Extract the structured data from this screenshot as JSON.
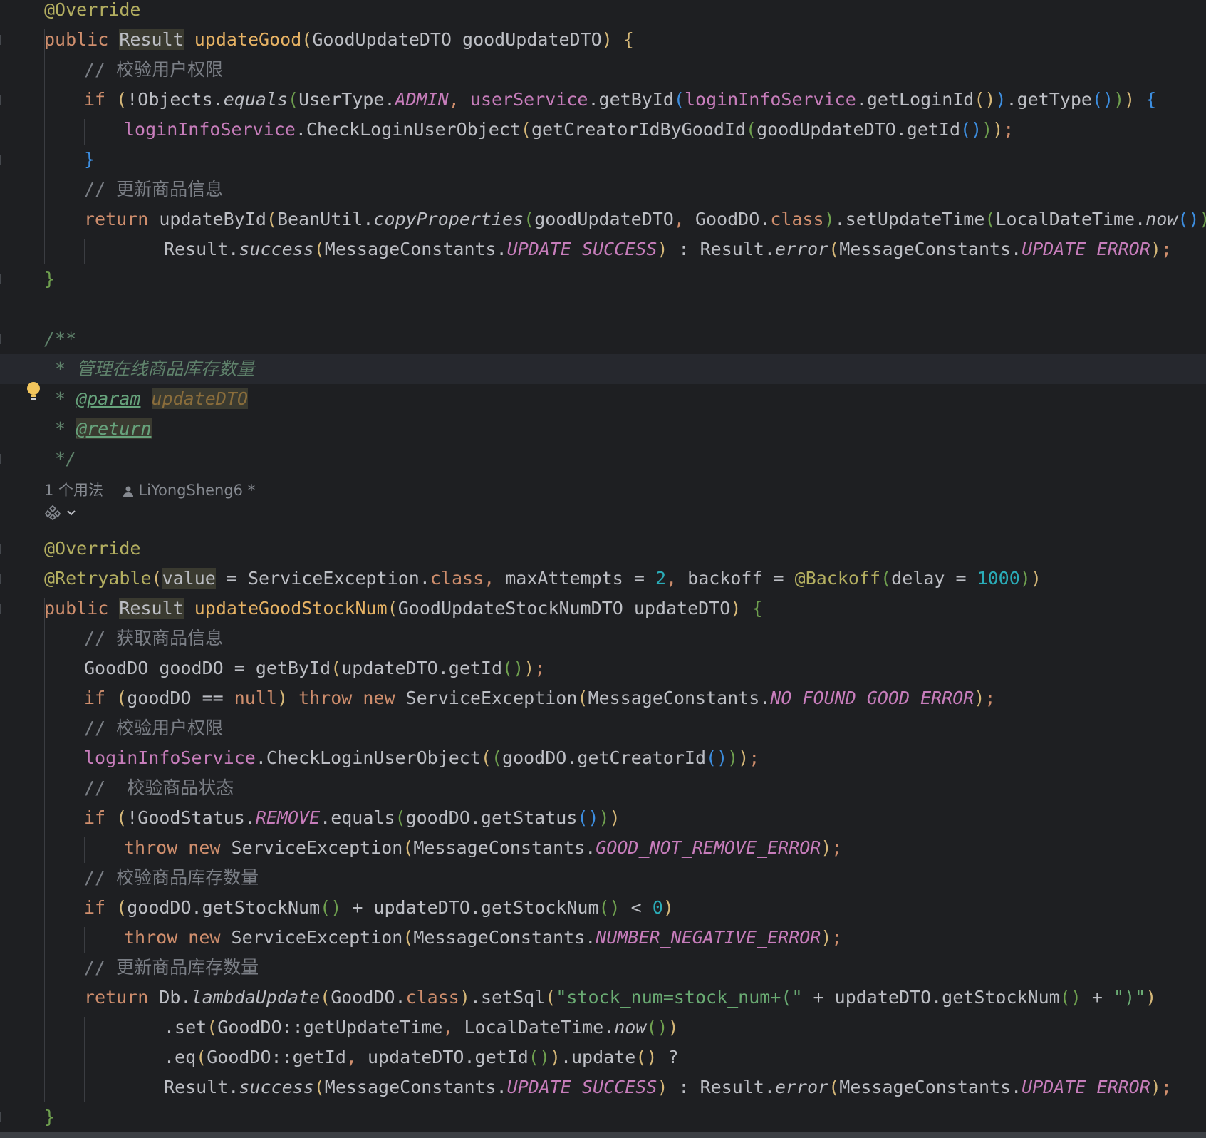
{
  "editor": {
    "language": "Java",
    "usage": {
      "count_label": "1 个用法",
      "author": "LiYongSheng6 *"
    }
  },
  "lines": [
    [
      [
        "ann",
        "@Override"
      ]
    ],
    [
      [
        "kw",
        "public "
      ],
      [
        "plain hl-bg",
        "Result"
      ],
      [
        "plain",
        " "
      ],
      [
        "fn",
        "updateGood"
      ],
      [
        "p1",
        "("
      ],
      [
        "plain",
        "GoodUpdateDTO goodUpdateDTO"
      ],
      [
        "p1",
        ")"
      ],
      [
        "plain",
        " "
      ],
      [
        "p1",
        "{"
      ]
    ],
    [
      [
        "cmt",
        "// 校验用户权限"
      ]
    ],
    [
      [
        "kw",
        "if "
      ],
      [
        "p1",
        "("
      ],
      [
        "plain",
        "!Objects."
      ],
      [
        "stat",
        "equals"
      ],
      [
        "p2",
        "("
      ],
      [
        "plain",
        "UserType."
      ],
      [
        "cnst",
        "ADMIN"
      ],
      [
        "kw",
        ", "
      ],
      [
        "fld",
        "userService"
      ],
      [
        "plain",
        ".getById"
      ],
      [
        "p3",
        "("
      ],
      [
        "fld",
        "loginInfoService"
      ],
      [
        "plain",
        ".getLoginId"
      ],
      [
        "p1",
        "()"
      ],
      [
        "p3",
        ")"
      ],
      [
        "plain",
        ".getType"
      ],
      [
        "p3",
        "()"
      ],
      [
        "p2",
        ")"
      ],
      [
        "p1",
        ")"
      ],
      [
        "plain",
        " "
      ],
      [
        "p3",
        "{"
      ]
    ],
    [
      [
        "fld",
        "loginInfoService"
      ],
      [
        "plain",
        ".CheckLoginUserObject"
      ],
      [
        "p1",
        "("
      ],
      [
        "plain",
        "getCreatorIdByGoodId"
      ],
      [
        "p2",
        "("
      ],
      [
        "plain",
        "goodUpdateDTO.getId"
      ],
      [
        "p3",
        "()"
      ],
      [
        "p2",
        ")"
      ],
      [
        "p1",
        ")"
      ],
      [
        "kw",
        ";"
      ]
    ],
    [
      [
        "p3",
        "}"
      ]
    ],
    [
      [
        "cmt",
        "// 更新商品信息"
      ]
    ],
    [
      [
        "kw",
        "return "
      ],
      [
        "plain",
        "updateById"
      ],
      [
        "p1",
        "("
      ],
      [
        "plain",
        "BeanUtil."
      ],
      [
        "stat",
        "copyProperties"
      ],
      [
        "p2",
        "("
      ],
      [
        "plain",
        "goodUpdateDTO"
      ],
      [
        "kw",
        ", "
      ],
      [
        "plain",
        "GoodDO."
      ],
      [
        "kw",
        "class"
      ],
      [
        "p2",
        ")"
      ],
      [
        "plain",
        ".setUpdateTime"
      ],
      [
        "p2",
        "("
      ],
      [
        "plain",
        "LocalDateTime."
      ],
      [
        "stat",
        "now"
      ],
      [
        "p3",
        "()"
      ],
      [
        "p2",
        ")"
      ],
      [
        "p1",
        ")"
      ],
      [
        "plain",
        " ?"
      ]
    ],
    [
      [
        "plain",
        "Result."
      ],
      [
        "stat",
        "success"
      ],
      [
        "p1",
        "("
      ],
      [
        "plain",
        "MessageConstants."
      ],
      [
        "cnst",
        "UPDATE_SUCCESS"
      ],
      [
        "p1",
        ")"
      ],
      [
        "plain",
        " : Result."
      ],
      [
        "stat",
        "error"
      ],
      [
        "p1",
        "("
      ],
      [
        "plain",
        "MessageConstants."
      ],
      [
        "cnst",
        "UPDATE_ERROR"
      ],
      [
        "p1",
        ")"
      ],
      [
        "kw",
        ";"
      ]
    ],
    [
      [
        "p2",
        "}"
      ]
    ],
    [],
    [
      [
        "doc",
        "/**"
      ]
    ],
    [
      [
        "doc",
        " * 管理在线商品库存数量"
      ]
    ],
    [
      [
        "doc",
        " * "
      ],
      [
        "doctag",
        "@param"
      ],
      [
        "doc",
        " "
      ],
      [
        "docvar hl-bg",
        "updateDTO"
      ]
    ],
    [
      [
        "doc",
        " * "
      ],
      [
        "doctag hl-bg",
        "@return"
      ]
    ],
    [
      [
        "doc",
        " */"
      ]
    ],
    [],
    [],
    [
      [
        "ann",
        "@Override"
      ]
    ],
    [
      [
        "ann",
        "@Retryable"
      ],
      [
        "p1",
        "("
      ],
      [
        "plain hl-bg",
        "value"
      ],
      [
        "plain",
        " = ServiceException."
      ],
      [
        "kw",
        "class"
      ],
      [
        "kw",
        ", "
      ],
      [
        "plain",
        "maxAttempts = "
      ],
      [
        "num",
        "2"
      ],
      [
        "kw",
        ", "
      ],
      [
        "plain",
        "backoff = "
      ],
      [
        "ann",
        "@Backoff"
      ],
      [
        "p2",
        "("
      ],
      [
        "plain",
        "delay = "
      ],
      [
        "num",
        "1000"
      ],
      [
        "p2",
        ")"
      ],
      [
        "p1",
        ")"
      ]
    ],
    [
      [
        "kw",
        "public "
      ],
      [
        "plain hl-bg",
        "Result"
      ],
      [
        "plain",
        " "
      ],
      [
        "fn",
        "updateGoodStockNum"
      ],
      [
        "p1",
        "("
      ],
      [
        "plain",
        "GoodUpdateStockNumDTO updateDTO"
      ],
      [
        "p1",
        ")"
      ],
      [
        "plain",
        " "
      ],
      [
        "p2",
        "{"
      ]
    ],
    [
      [
        "cmt",
        "// 获取商品信息"
      ]
    ],
    [
      [
        "plain",
        "GoodDO goodDO = getById"
      ],
      [
        "p1",
        "("
      ],
      [
        "plain",
        "updateDTO.getId"
      ],
      [
        "p2",
        "()"
      ],
      [
        "p1",
        ")"
      ],
      [
        "kw",
        ";"
      ]
    ],
    [
      [
        "kw",
        "if "
      ],
      [
        "p1",
        "("
      ],
      [
        "plain",
        "goodDO == "
      ],
      [
        "kw",
        "null"
      ],
      [
        "p1",
        ")"
      ],
      [
        "plain",
        " "
      ],
      [
        "kw",
        "throw new "
      ],
      [
        "plain",
        "ServiceException"
      ],
      [
        "p1",
        "("
      ],
      [
        "plain",
        "MessageConstants."
      ],
      [
        "cnst",
        "NO_FOUND_GOOD_ERROR"
      ],
      [
        "p1",
        ")"
      ],
      [
        "kw",
        ";"
      ]
    ],
    [
      [
        "cmt",
        "// 校验用户权限"
      ]
    ],
    [
      [
        "fld",
        "loginInfoService"
      ],
      [
        "plain",
        ".CheckLoginUserObject"
      ],
      [
        "p1",
        "("
      ],
      [
        "p2",
        "("
      ],
      [
        "plain",
        "goodDO.getCreatorId"
      ],
      [
        "p3",
        "()"
      ],
      [
        "p2",
        ")"
      ],
      [
        "p1",
        ")"
      ],
      [
        "kw",
        ";"
      ]
    ],
    [
      [
        "cmt",
        "//  校验商品状态"
      ]
    ],
    [
      [
        "kw",
        "if "
      ],
      [
        "p1",
        "("
      ],
      [
        "plain",
        "!GoodStatus."
      ],
      [
        "cnst",
        "REMOVE"
      ],
      [
        "plain",
        ".equals"
      ],
      [
        "p2",
        "("
      ],
      [
        "plain",
        "goodDO.getStatus"
      ],
      [
        "p3",
        "()"
      ],
      [
        "p2",
        ")"
      ],
      [
        "p1",
        ")"
      ]
    ],
    [
      [
        "kw",
        "throw new "
      ],
      [
        "plain",
        "ServiceException"
      ],
      [
        "p1",
        "("
      ],
      [
        "plain",
        "MessageConstants."
      ],
      [
        "cnst",
        "GOOD_NOT_REMOVE_ERROR"
      ],
      [
        "p1",
        ")"
      ],
      [
        "kw",
        ";"
      ]
    ],
    [
      [
        "cmt",
        "// 校验商品库存数量"
      ]
    ],
    [
      [
        "kw",
        "if "
      ],
      [
        "p1",
        "("
      ],
      [
        "plain",
        "goodDO.getStockNum"
      ],
      [
        "p2",
        "()"
      ],
      [
        "plain",
        " + updateDTO.getStockNum"
      ],
      [
        "p2",
        "()"
      ],
      [
        "plain",
        " < "
      ],
      [
        "num",
        "0"
      ],
      [
        "p1",
        ")"
      ]
    ],
    [
      [
        "kw",
        "throw new "
      ],
      [
        "plain",
        "ServiceException"
      ],
      [
        "p1",
        "("
      ],
      [
        "plain",
        "MessageConstants."
      ],
      [
        "cnst",
        "NUMBER_NEGATIVE_ERROR"
      ],
      [
        "p1",
        ")"
      ],
      [
        "kw",
        ";"
      ]
    ],
    [
      [
        "cmt",
        "// 更新商品库存数量"
      ]
    ],
    [
      [
        "kw",
        "return "
      ],
      [
        "plain",
        "Db."
      ],
      [
        "stat",
        "lambdaUpdate"
      ],
      [
        "p1",
        "("
      ],
      [
        "plain",
        "GoodDO."
      ],
      [
        "kw",
        "class"
      ],
      [
        "p1",
        ")"
      ],
      [
        "plain",
        ".setSql"
      ],
      [
        "p1",
        "("
      ],
      [
        "str",
        "\"stock_num=stock_num+(\""
      ],
      [
        "plain",
        " + updateDTO.getStockNum"
      ],
      [
        "p2",
        "()"
      ],
      [
        "plain",
        " + "
      ],
      [
        "str",
        "\")\""
      ],
      [
        "p1",
        ")"
      ]
    ],
    [
      [
        "plain",
        ".set"
      ],
      [
        "p1",
        "("
      ],
      [
        "plain",
        "GoodDO::getUpdateTime"
      ],
      [
        "kw",
        ", "
      ],
      [
        "plain",
        "LocalDateTime."
      ],
      [
        "stat",
        "now"
      ],
      [
        "p2",
        "()"
      ],
      [
        "p1",
        ")"
      ]
    ],
    [
      [
        "plain",
        ".eq"
      ],
      [
        "p1",
        "("
      ],
      [
        "plain",
        "GoodDO::getId"
      ],
      [
        "kw",
        ", "
      ],
      [
        "plain",
        "updateDTO.getId"
      ],
      [
        "p2",
        "()"
      ],
      [
        "p1",
        ")"
      ],
      [
        "plain",
        ".update"
      ],
      [
        "p1",
        "()"
      ],
      [
        "plain",
        " ?"
      ]
    ],
    [
      [
        "plain",
        "Result."
      ],
      [
        "stat",
        "success"
      ],
      [
        "p1",
        "("
      ],
      [
        "plain",
        "MessageConstants."
      ],
      [
        "cnst",
        "UPDATE_SUCCESS"
      ],
      [
        "p1",
        ")"
      ],
      [
        "plain",
        " : Result."
      ],
      [
        "stat",
        "error"
      ],
      [
        "p1",
        "("
      ],
      [
        "plain",
        "MessageConstants."
      ],
      [
        "cnst",
        "UPDATE_ERROR"
      ],
      [
        "p1",
        ")"
      ],
      [
        "kw",
        ";"
      ]
    ],
    [
      [
        "p2",
        "}"
      ]
    ]
  ],
  "icons": {
    "intention": "lightbulb-icon",
    "ai_assist": "ai-assist-icon",
    "user": "user-icon",
    "chevron": "chevron-down-icon"
  },
  "colors": {
    "background": "#1e1f22",
    "keyword": "#cf8e6d",
    "method": "#e6b264",
    "annotation": "#b3ae60",
    "field": "#c77dbb",
    "number": "#2aacb8",
    "string": "#6aab73",
    "comment": "#7a7e85",
    "doc": "#5f826b"
  }
}
